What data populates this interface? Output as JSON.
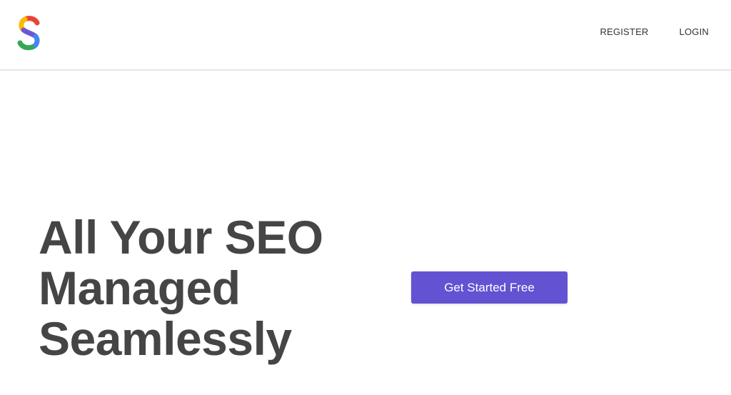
{
  "header": {
    "logo_icon": "s-logo-icon",
    "nav": [
      {
        "label": "REGISTER"
      },
      {
        "label": "LOGIN"
      }
    ]
  },
  "hero": {
    "title_lines": [
      "All Your SEO",
      "Managed",
      "Seamlessly"
    ],
    "cta_label": "Get Started Free"
  },
  "colors": {
    "accent": "#6352d2",
    "heading": "#454545",
    "logo_red": "#ea4335",
    "logo_yellow": "#fbbc05",
    "logo_green": "#34a853",
    "logo_blue": "#4285f4",
    "logo_purple": "#6f55d6"
  }
}
